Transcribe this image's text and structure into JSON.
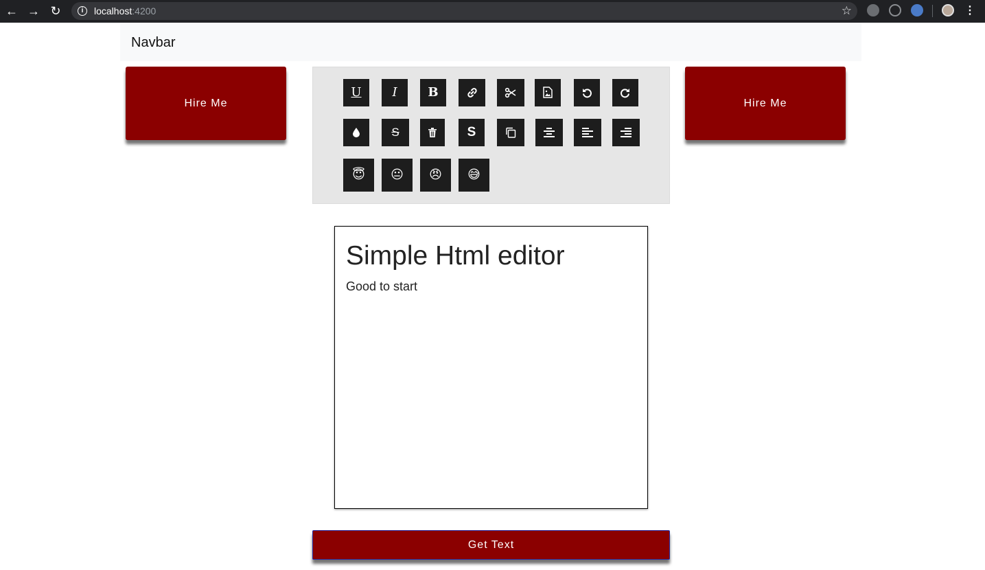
{
  "browser": {
    "url_host": "localhost",
    "url_port": ":4200"
  },
  "navbar": {
    "brand": "Navbar"
  },
  "hire_left": {
    "label": "Hire Me"
  },
  "hire_right": {
    "label": "Hire Me"
  },
  "toolbar": {
    "row1": [
      "underline",
      "italic",
      "bold",
      "link",
      "cut",
      "image",
      "undo",
      "redo"
    ],
    "row2": [
      "color",
      "strikethrough",
      "delete",
      "clear-format",
      "copy",
      "align-center",
      "align-left",
      "align-right"
    ],
    "row3": [
      "smiling-face-with-halo",
      "neutral-face",
      "angry-face",
      "grinning-face-with-sweat"
    ],
    "underline_glyph": "U",
    "italic_glyph": "I",
    "bold_glyph": "B",
    "strike_glyph": "S",
    "clear_glyph": "S",
    "emoji": [
      "😇",
      "😐",
      "😠",
      "😅"
    ]
  },
  "editor": {
    "heading": "Simple Html editor",
    "body": "Good to start"
  },
  "get_text": {
    "label": "Get Text"
  }
}
